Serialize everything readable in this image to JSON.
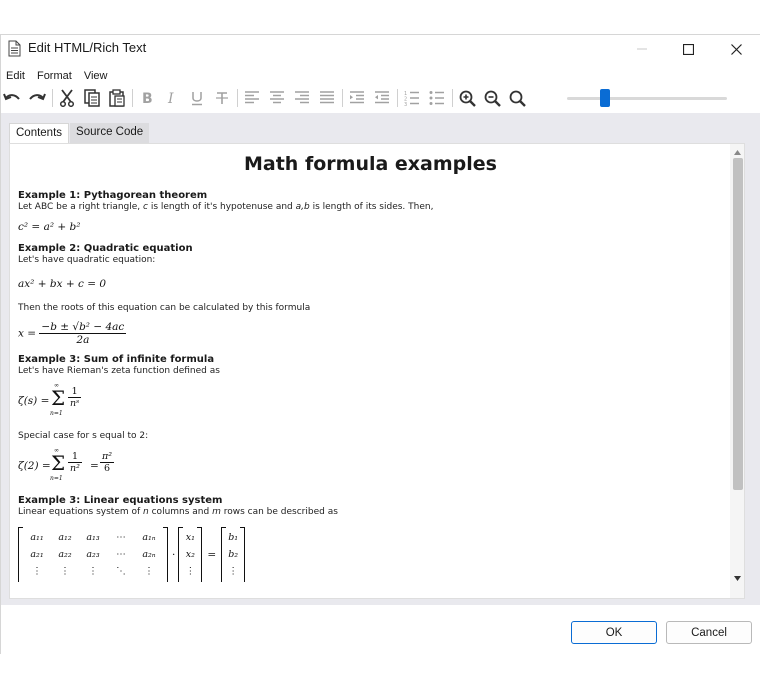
{
  "window": {
    "title": "Edit HTML/Rich Text"
  },
  "menu": [
    "Edit",
    "Format",
    "View"
  ],
  "toolbar": {
    "icons": [
      "undo-icon",
      "redo-icon",
      "cut-icon",
      "copy-icon",
      "paste-icon",
      "bold-icon",
      "italic-icon",
      "underline-icon",
      "strikethrough-icon",
      "align-left-icon",
      "align-center-icon",
      "align-right-icon",
      "justify-icon",
      "indent-icon",
      "outdent-icon",
      "numbered-list-icon",
      "bulleted-list-icon",
      "zoom-in-icon",
      "zoom-out-icon",
      "zoom-reset-icon"
    ],
    "zoom_slider_value": 0.22,
    "accent": "#0a6cd4"
  },
  "tabs": [
    "Contents",
    "Source Code"
  ],
  "document": {
    "title": "Math formula examples",
    "ex1": {
      "heading": "Example 1: Pythagorean theorem",
      "text_a": "Let ABC be a right triangle, ",
      "text_c": "c",
      "text_b": " is length of it's hypotenuse and ",
      "text_ab": "a,b",
      "text_d": " is length of its sides. Then,",
      "formula": "c² = a² + b²"
    },
    "ex2": {
      "heading": "Example 2: Quadratic equation",
      "text": "Let's have quadratic equation:",
      "formula": "ax² + bx + c = 0",
      "text2": "Then the roots of this equation can be calculated by this formula",
      "lhs": "x =",
      "num": "−b ± √b² − 4ac",
      "den": "2a"
    },
    "ex3": {
      "heading": "Example 3: Sum of infinite formula",
      "text": "Let's have Rieman's zeta function defined as",
      "lhs": "ζ(s) =",
      "sum_top": "∞",
      "sum_bottom": "n=1",
      "num": "1",
      "den": "nˢ",
      "text2": "Special case for s equal to 2:",
      "lhs2": "ζ(2) =",
      "den2": "n²",
      "eq2": "=",
      "num3": "π²",
      "den3": "6"
    },
    "ex4": {
      "heading": "Example 3: Linear equations system",
      "text_a": "Linear equations system of ",
      "text_n": "n",
      "text_b": " columns and ",
      "text_m": "m",
      "text_c": " rows can be described as",
      "matrix_rows": [
        [
          "a₁₁",
          "a₁₂",
          "a₁₃",
          "⋯",
          "a₁ₙ"
        ],
        [
          "a₂₁",
          "a₂₂",
          "a₂₃",
          "⋯",
          "a₂ₙ"
        ],
        [
          "⋮",
          "⋮",
          "⋮",
          "⋱",
          "⋮"
        ]
      ],
      "dot": "·",
      "x_rows": [
        "x₁",
        "x₂",
        "⋮"
      ],
      "eq": "=",
      "b_rows": [
        "b₁",
        "b₂",
        "⋮"
      ]
    }
  },
  "buttons": {
    "ok": "OK",
    "cancel": "Cancel"
  }
}
